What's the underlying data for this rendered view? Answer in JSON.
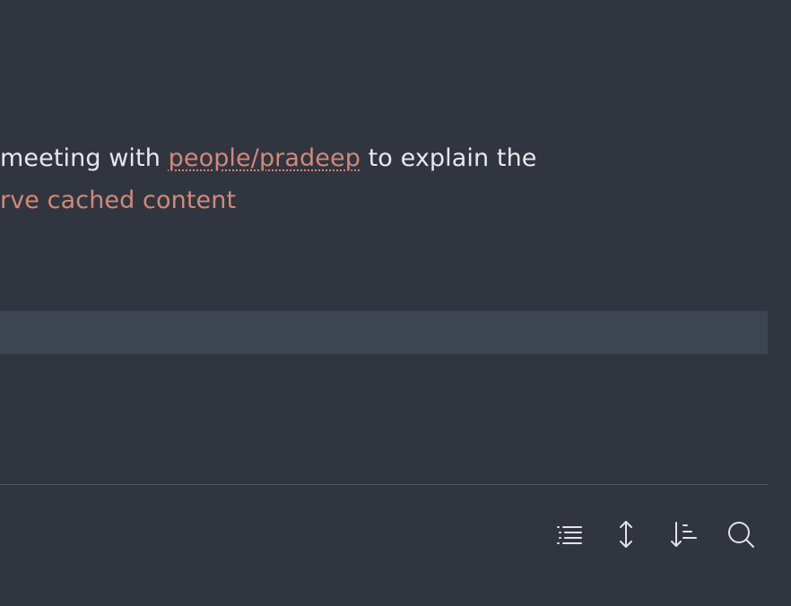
{
  "editor": {
    "line1": {
      "before": "meeting with ",
      "link": "people/pradeep",
      "after": " to explain the"
    },
    "line2": {
      "link": "rve cached content"
    }
  },
  "toolbar": {
    "icons": [
      "outline-list-icon",
      "expand-vertical-icon",
      "sort-descending-icon",
      "search-icon"
    ]
  },
  "colors": {
    "background": "#31353f",
    "text": "#e8e9ec",
    "link": "#d1897b",
    "highlight_row": "#3d4553"
  }
}
